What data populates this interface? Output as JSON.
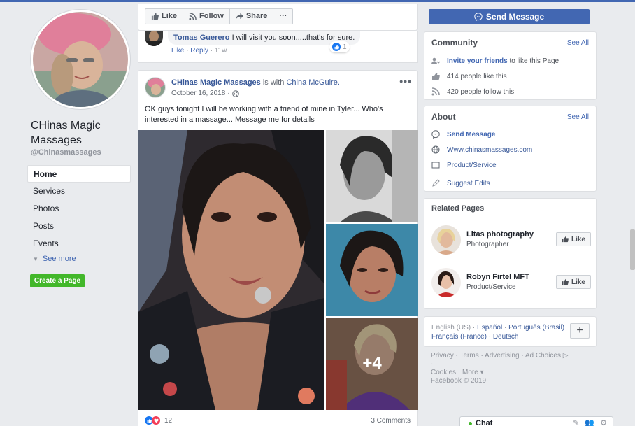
{
  "page": {
    "name": "CHinas Magic Massages",
    "handle": "@Chinasmassages"
  },
  "nav": {
    "items": [
      "Home",
      "Services",
      "Photos",
      "Posts",
      "Events"
    ],
    "see_more": "See more",
    "create_page": "Create a Page"
  },
  "actionbar": {
    "like": "Like",
    "follow": "Follow",
    "share": "Share",
    "more": "···",
    "send_message": "Send Message"
  },
  "top_comment": {
    "author": "Tomas Guerero",
    "text": "I will visit you soon.....that's for sure.",
    "like": "Like",
    "reply": "Reply",
    "age": "11w",
    "reaction_count": "1"
  },
  "post": {
    "author": "CHinas Magic Massages",
    "with_text": "is with",
    "tagged": "China McGuire.",
    "date": "October 16, 2018",
    "sep": "·",
    "text": "OK guys tonight I will be working with a friend of mine in Tyler... Who's interested in a massage... Message me for details",
    "more_photos": "+4",
    "reactions_count": "12",
    "comments_count": "3 Comments",
    "menu": "•••"
  },
  "community": {
    "title": "Community",
    "see_all": "See All",
    "invite_link": "Invite your friends",
    "invite_rest": "to like this Page",
    "likes": "414 people like this",
    "follows": "420 people follow this"
  },
  "about": {
    "title": "About",
    "see_all": "See All",
    "send_message": "Send Message",
    "website": "Www.chinasmassages.com",
    "category": "Product/Service",
    "suggest": "Suggest Edits"
  },
  "related": {
    "title": "Related Pages",
    "like_label": "Like",
    "pages": [
      {
        "name": "Litas photography",
        "category": "Photographer"
      },
      {
        "name": "Robyn Firtel MFT",
        "category": "Product/Service"
      }
    ]
  },
  "languages": {
    "current": "English (US)",
    "sep": "·",
    "options": [
      "Español",
      "Português (Brasil)",
      "Français (France)",
      "Deutsch"
    ],
    "plus": "+"
  },
  "footer": {
    "line1": "Privacy · Terms · Advertising · Ad Choices ▷ ·",
    "line2": "Cookies · More ▾",
    "copyright": "Facebook © 2019"
  },
  "chat": {
    "label": "Chat"
  },
  "colors": {
    "brand": "#4267b2",
    "link": "#385898",
    "green": "#42b72a",
    "background": "#e9ebee"
  }
}
